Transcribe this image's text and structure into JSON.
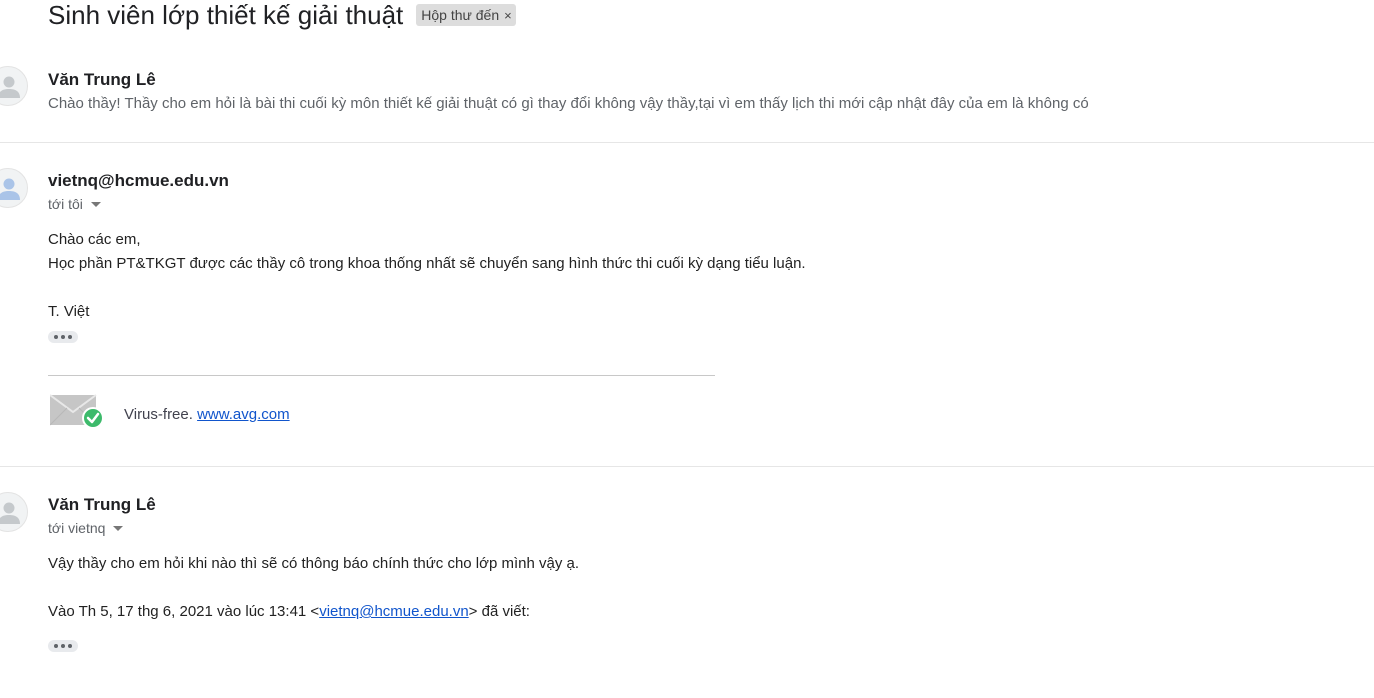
{
  "thread": {
    "subject": "Sinh viên lớp thiết kế giải thuật",
    "label": "Hộp thư đến",
    "label_remove": "×"
  },
  "messages": [
    {
      "sender": "Văn Trung Lê",
      "snippet": "Chào thầy! Thầy cho em hỏi là bài thi cuối kỳ môn thiết kế giải thuật có gì thay đổi không vậy thầy,tại vì em thấy lịch thi mới cập nhật đây của em là không có"
    },
    {
      "sender": "vietnq@hcmue.edu.vn",
      "recipient": "tới tôi",
      "body": [
        "Chào các em,",
        "Học phần PT&TKGT được các thầy cô trong khoa thống nhất sẽ chuyển sang hình thức thi cuối kỳ dạng tiểu luận.",
        "T. Việt"
      ],
      "signature": {
        "text": "Virus-free.",
        "link": "www.avg.com"
      }
    },
    {
      "sender": "Văn Trung Lê",
      "recipient": "tới vietnq",
      "body": [
        "Vậy thầy cho em hỏi khi nào thì sẽ có thông báo chính thức cho lớp mình vậy ạ."
      ],
      "quote": {
        "prefix": "Vào Th 5, 17 thg 6, 2021 vào lúc 13:41 <",
        "email": "vietnq@hcmue.edu.vn",
        "suffix": "> đã viết:"
      }
    }
  ],
  "icons": {
    "avatar": "default-person-icon",
    "recipient_dropdown": "caret-down-icon",
    "show_trimmed": "ellipsis-icon",
    "avg": "envelope-check-icon"
  },
  "colors": {
    "label_chip": "#dddddd",
    "link": "#1155cc",
    "check_green": "#3dba6b"
  }
}
